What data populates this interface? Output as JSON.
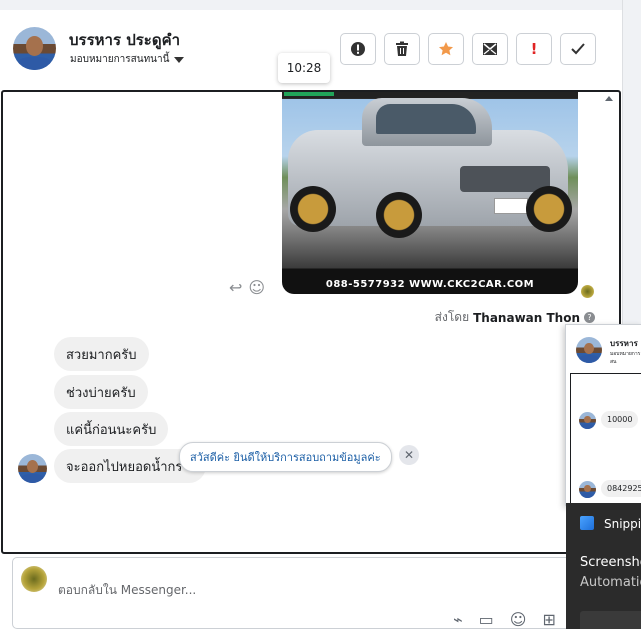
{
  "header": {
    "contact_name": "บรรหาร ประดูคำ",
    "assign_label": "มอบหมายการสนทนานี้",
    "actions": [
      {
        "icon": "alert-circle-icon",
        "label": "!"
      },
      {
        "icon": "trash-icon",
        "label": ""
      },
      {
        "icon": "star-icon",
        "label": ""
      },
      {
        "icon": "mark-unread-icon",
        "label": ""
      },
      {
        "icon": "spam-icon",
        "label": "!"
      },
      {
        "icon": "check-icon",
        "label": ""
      }
    ]
  },
  "tooltip": {
    "time": "10:28"
  },
  "conversation": {
    "image_caption": "088-5577932 WWW.CKC2CAR.COM",
    "sent_by_prefix": "ส่งโดย",
    "sent_by_name": "Thanawan Thon",
    "messages": [
      "สวยมากครับ",
      "ช่วงบ่ายครับ",
      "แค่นี้ก่อนนะครับ",
      "จะออกไปหยอดน้ำกร"
    ],
    "suggestion": "สวัสดีค่ะ ยินดีให้บริการสอบถามข้อมูลค่ะ"
  },
  "composer": {
    "placeholder": "ตอบกลับใน Messenger..."
  },
  "mini_window": {
    "name": "บรรหาร",
    "sub": "มอบหมายการสน",
    "messages": [
      "10000",
      "08429251"
    ]
  },
  "toast": {
    "title": "Snippi",
    "line1": "Screensho",
    "line2": "Automatio"
  }
}
